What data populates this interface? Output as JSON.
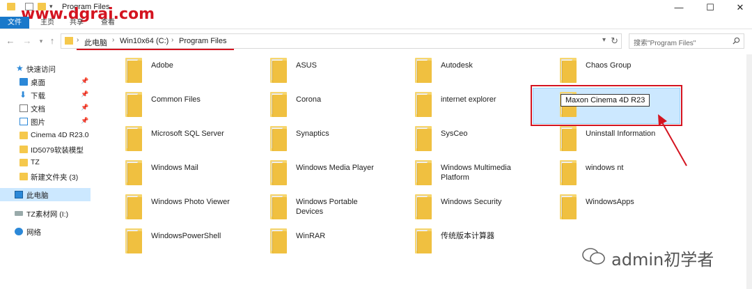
{
  "watermark": "www.dgrai.com",
  "window": {
    "title": "Program Files",
    "minimize": "—",
    "maximize": "☐",
    "close": "✕"
  },
  "ribbon": {
    "tabs": [
      "文件",
      "主页",
      "共享",
      "查看"
    ]
  },
  "address": {
    "crumbs": [
      "此电脑",
      "Win10x64 (C:)",
      "Program Files"
    ],
    "search_placeholder": "搜索\"Program Files\""
  },
  "sidebar": {
    "items": [
      {
        "label": "快速访问",
        "icon": "star-icon",
        "pinned": false
      },
      {
        "label": "桌面",
        "icon": "desktop-icon",
        "pinned": true
      },
      {
        "label": "下载",
        "icon": "download-icon",
        "pinned": true
      },
      {
        "label": "文档",
        "icon": "document-icon",
        "pinned": true
      },
      {
        "label": "图片",
        "icon": "picture-icon",
        "pinned": true
      },
      {
        "label": "Cinema 4D R23.0",
        "icon": "folder-icon",
        "pinned": false
      },
      {
        "label": "ID5079软装模型",
        "icon": "folder-icon",
        "pinned": false
      },
      {
        "label": "TZ",
        "icon": "folder-icon",
        "pinned": false
      },
      {
        "label": "新建文件夹 (3)",
        "icon": "folder-icon",
        "pinned": false
      },
      {
        "label": "此电脑",
        "icon": "computer-icon",
        "pinned": false
      },
      {
        "label": "TZ素材网 (I:)",
        "icon": "drive-icon",
        "pinned": false
      },
      {
        "label": "网络",
        "icon": "network-icon",
        "pinned": false
      }
    ]
  },
  "folders": [
    [
      "Adobe",
      "ASUS",
      "Autodesk",
      "Chaos Group"
    ],
    [
      "Common Files",
      "Corona",
      "internet explorer",
      "Maxon Cinema 4D R23"
    ],
    [
      "Microsoft SQL Server",
      "Synaptics",
      "SysCeo",
      "Uninstall Information"
    ],
    [
      "Windows Mail",
      "Windows Media Player",
      "Windows Multimedia Platform",
      "windows nt"
    ],
    [
      "Windows Photo Viewer",
      "Windows Portable Devices",
      "Windows Security",
      "WindowsApps"
    ],
    [
      "WindowsPowerShell",
      "WinRAR",
      "传统版本计算器"
    ]
  ],
  "rename_value": "Maxon Cinema 4D R23",
  "brand": "admin初学者",
  "colors": {
    "accent": "#1979ca",
    "highlight": "#d41420",
    "selection": "#cce8ff"
  }
}
